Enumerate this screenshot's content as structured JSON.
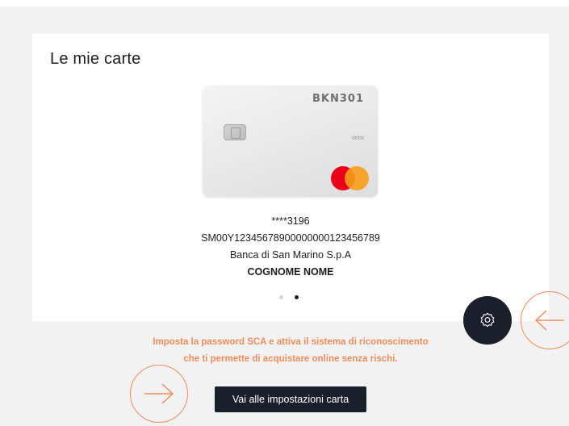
{
  "panel": {
    "title": "Le mie carte"
  },
  "card": {
    "brand_logo": "BKN301",
    "type_label": "debit",
    "network_icon": "mastercard-icon",
    "chip_icon": "chip-icon"
  },
  "card_info": {
    "masked_number": "****3196",
    "iban": "SM00Y12345678900000000123456789",
    "bank_name": "Banca di San Marino S.p.A",
    "holder_name": "COGNOME NOME"
  },
  "carousel": {
    "total": 2,
    "active_index": 1
  },
  "notice": {
    "line1": "Imposta la password SCA e attiva il sistema di riconoscimento",
    "line2": "che ti permette di acquistare online senza rischi."
  },
  "actions": {
    "settings_label": "Vai alle impostazioni carta",
    "gear_icon": "gear-icon",
    "prev_icon": "arrow-left-icon",
    "next_icon": "arrow-right-icon"
  },
  "colors": {
    "accent": "#f28b5b",
    "dark": "#1a1f2b",
    "background": "#f2f2f2",
    "panel": "#ffffff"
  }
}
